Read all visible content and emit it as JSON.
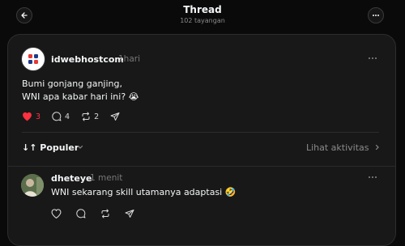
{
  "header": {
    "title": "Thread",
    "views": "102 tayangan"
  },
  "post": {
    "username": "idwebhostcom",
    "time": "1hari",
    "line1": "Bumi gonjang ganjing,",
    "line2": "WNI apa kabar hari ini? 😭",
    "likes": "3",
    "comments": "4",
    "reposts": "2",
    "liked": true
  },
  "sort": {
    "label": "↓↑ Populer",
    "activity": "Lihat aktivitas"
  },
  "reply": {
    "username": "dheteye",
    "time": "1 menit",
    "text": "WNI sekarang skill utamanya adaptasi 🤣"
  },
  "colors": {
    "like": "#ff3040",
    "brand_red": "#e53935",
    "brand_blue": "#1e3a8a"
  },
  "icons": {
    "back": "arrow-left-icon",
    "more": "more-horizontal-icon",
    "like": "heart-icon",
    "comment": "comment-icon",
    "repost": "repost-icon",
    "share": "send-icon",
    "chevron": "chevron-down-icon",
    "chevron_right": "chevron-right-icon"
  }
}
